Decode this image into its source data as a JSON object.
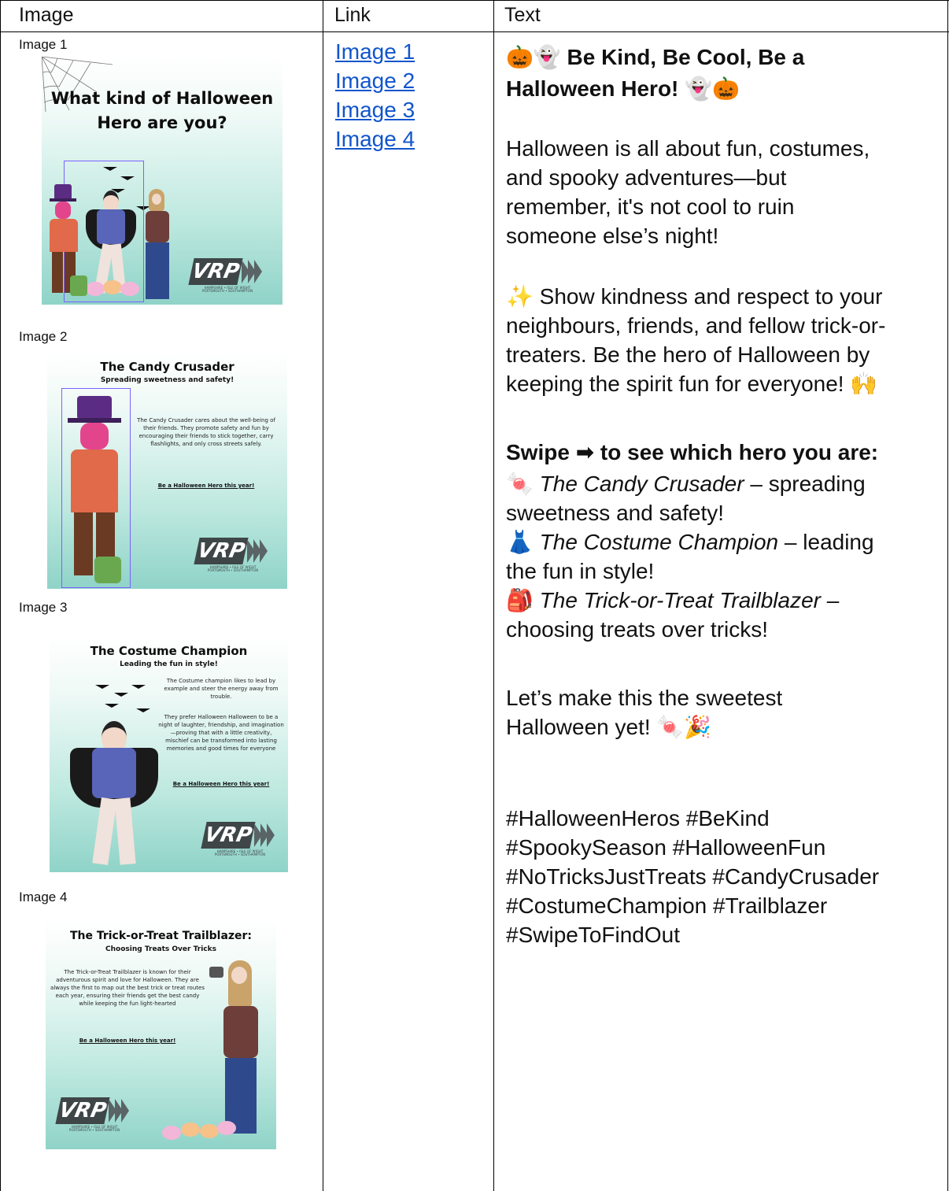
{
  "table": {
    "headers": [
      "Image",
      "Link",
      "Text"
    ]
  },
  "images": [
    {
      "label": "Image 1",
      "poster_title": "What kind of Halloween Hero are you?"
    },
    {
      "label": "Image 2",
      "poster_title": "The Candy Crusader",
      "poster_subtitle": "Spreading sweetness and safety!",
      "poster_body": "The Candy Crusader cares about the well-being of their friends. They promote safety and fun by encouraging their friends to stick together, carry flashlights, and only cross streets safely.",
      "poster_cta": "Be a Halloween Hero this year!"
    },
    {
      "label": "Image 3",
      "poster_title": "The Costume Champion",
      "poster_subtitle": "Leading the fun in style!",
      "poster_body": "The Costume champion likes to lead by example and steer the energy away from trouble.",
      "poster_body2": "They prefer Halloween Halloween to be a night of laughter, friendship, and imagination—proving that with a little creativity, mischief can be transformed into lasting memories and good times for everyone",
      "poster_cta": "Be a Halloween Hero this year!"
    },
    {
      "label": "Image 4",
      "poster_title": "The Trick-or-Treat Trailblazer:",
      "poster_subtitle": "Choosing Treats Over Tricks",
      "poster_body": "The Trick-or-Treat Trailblazer is known for their adventurous spirit and love for Halloween. They are always the first to map out the best trick or treat routes each year, ensuring their friends get the best candy while keeping the fun light-hearted",
      "poster_cta": "Be a Halloween Hero this year!"
    }
  ],
  "logo": {
    "text": "VRP",
    "caption_line1": "HAMPSHIRE • ISLE OF WIGHT",
    "caption_line2": "PORTSMOUTH • SOUTHAMPTON"
  },
  "links": [
    "Image 1",
    "Image 2",
    "Image 3",
    "Image 4"
  ],
  "text": {
    "heading_line1": " Be Kind, Be Cool, Be a",
    "heading_line2": "Halloween Hero! ",
    "heading_emoji_start": "🎃👻",
    "heading_emoji_end": "👻🎃",
    "para1": [
      "Halloween is all about fun, costumes,",
      "and spooky adventures—but",
      "remember, it's not cool to ruin",
      "someone else’s night!"
    ],
    "para2": [
      "✨ Show kindness and respect to your",
      "neighbours, friends, and fellow trick-or-",
      "treaters. Be the hero of Halloween by",
      "keeping the spirit fun for everyone! 🙌"
    ],
    "swipe_heading": "Swipe ➡ to see which hero you are:",
    "heroes": [
      {
        "emoji": "🍬",
        "name": "The Candy Crusader",
        "desc_line1": " – spreading",
        "desc_line2": "sweetness and safety!"
      },
      {
        "emoji": "👗",
        "name": "The Costume Champion",
        "desc_line1": " – leading",
        "desc_line2": "the fun in style!"
      },
      {
        "emoji": "🎒",
        "name": "The Trick-or-Treat Trailblazer",
        "desc_line1": " –",
        "desc_line2": "choosing treats over tricks!"
      }
    ],
    "closing": [
      "Let’s make this the sweetest",
      "Halloween yet! 🍬🎉"
    ],
    "hashtags": [
      "#HalloweenHeros #BeKind",
      "#SpookySeason #HalloweenFun",
      "#NoTricksJustTreats #CandyCrusader",
      "#CostumeChampion #Trailblazer",
      "#SwipeToFindOut"
    ]
  },
  "colors": {
    "link": "#1155cc",
    "poster_teal": "#8fd3c8",
    "logo_gray": "#3f4648"
  }
}
